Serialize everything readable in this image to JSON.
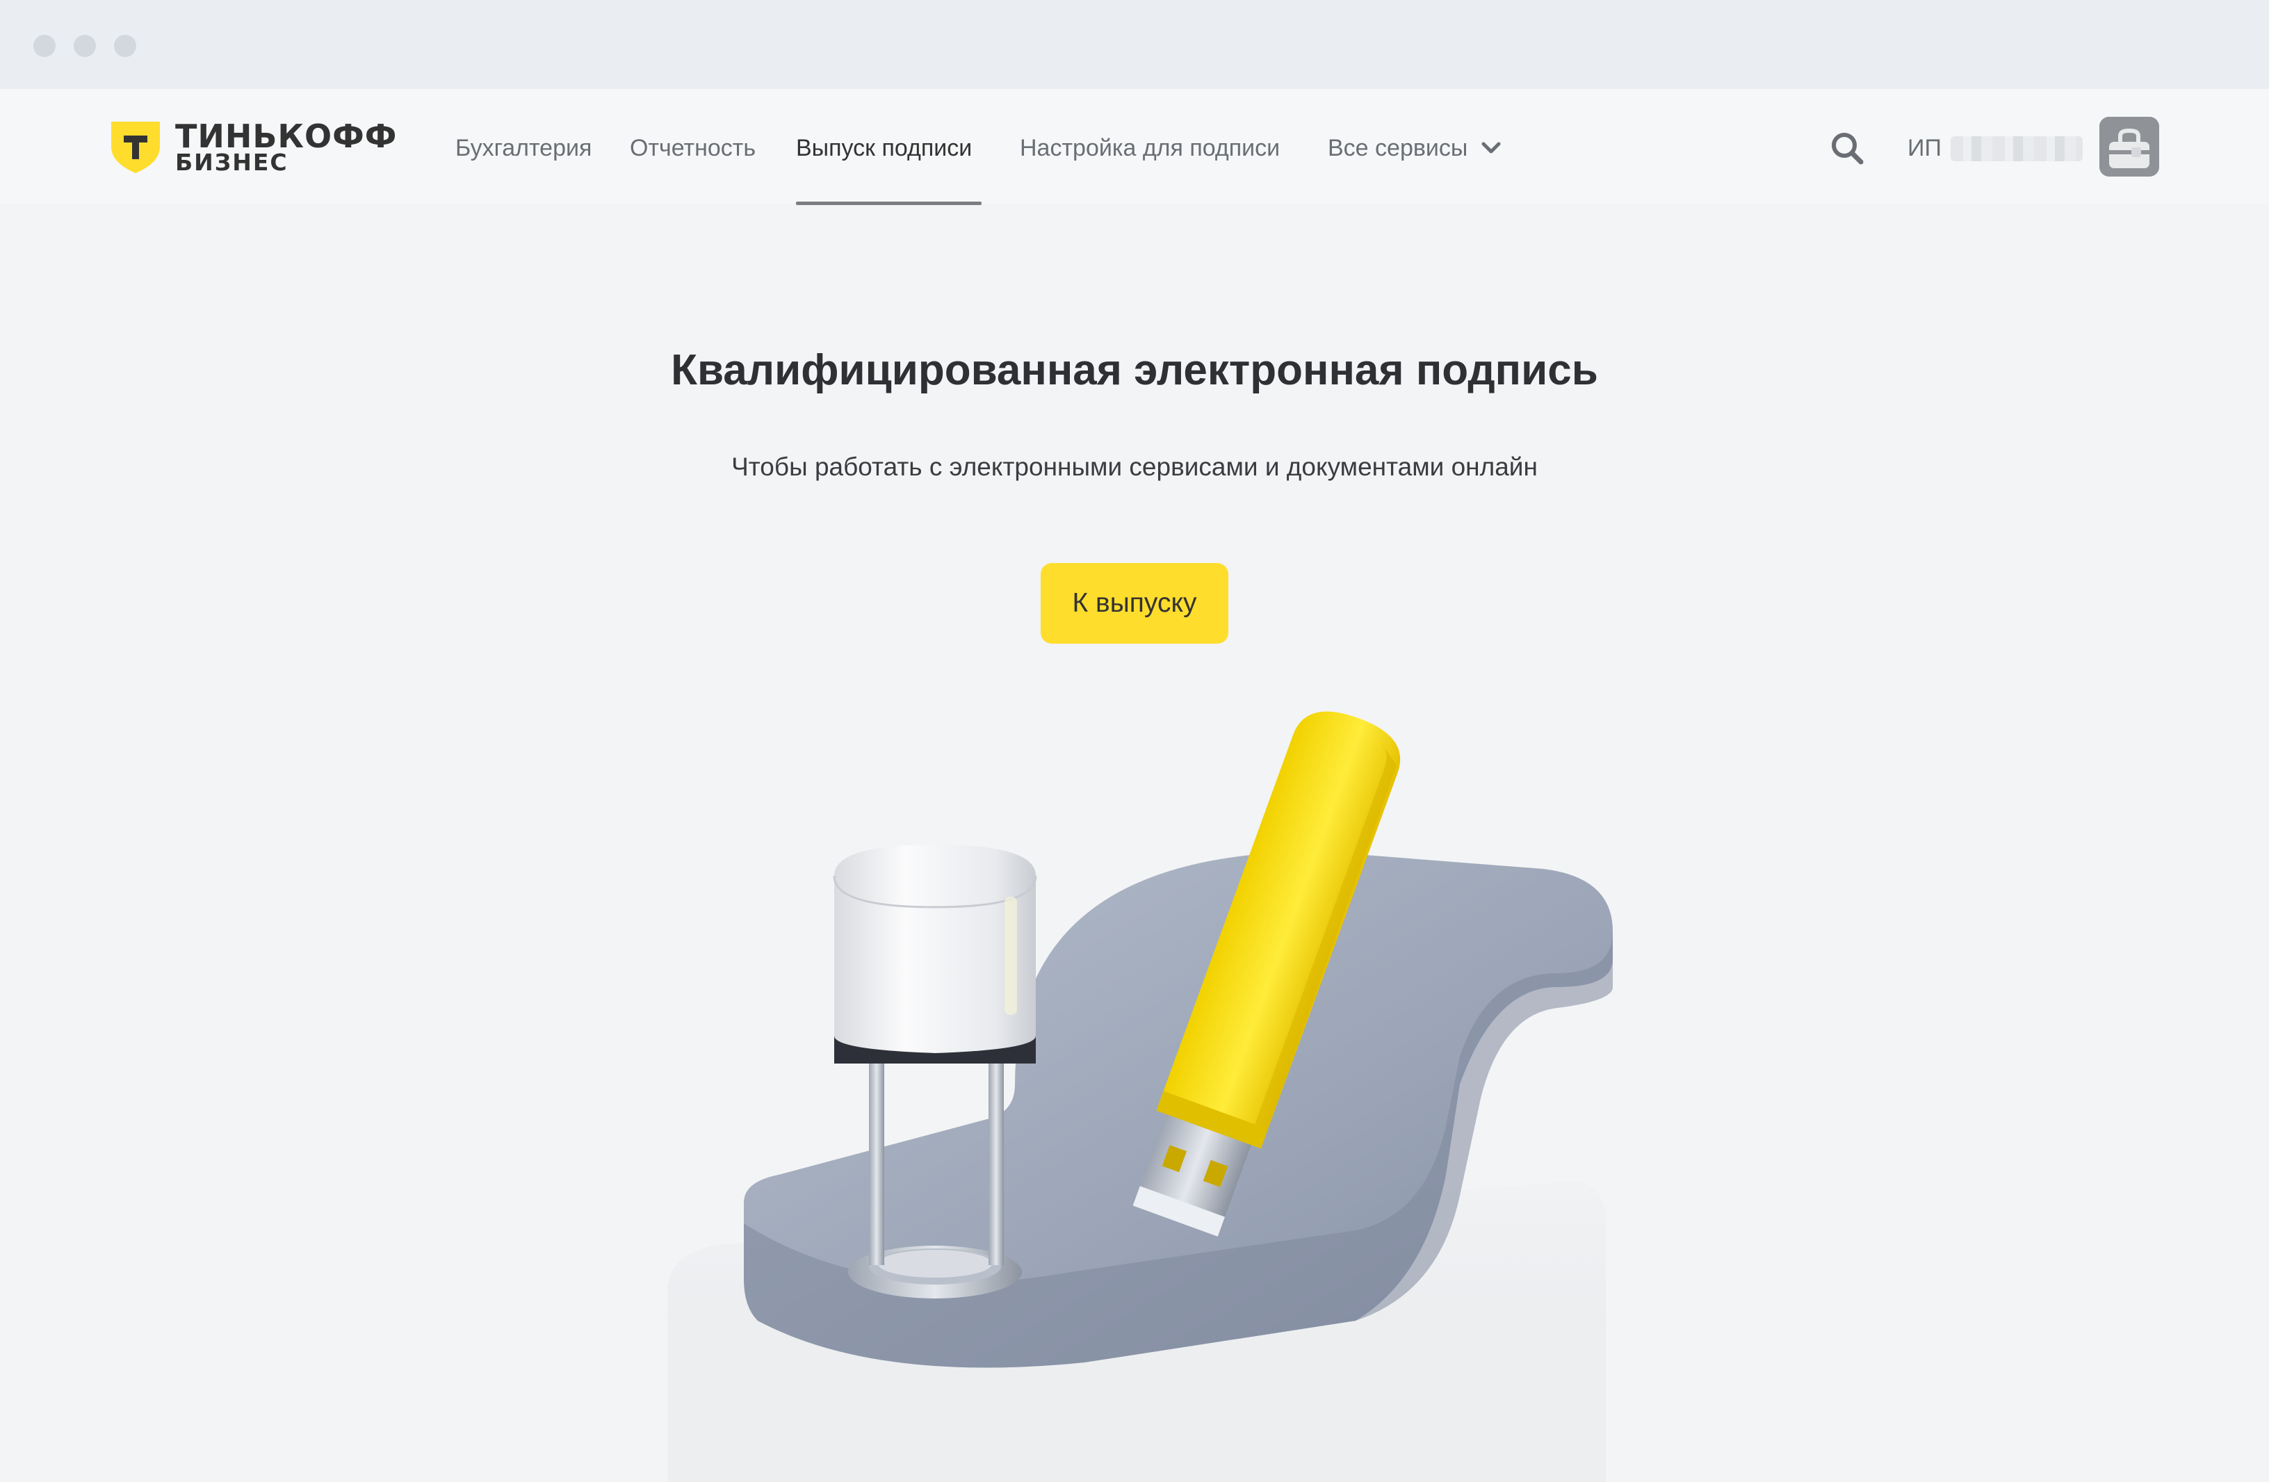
{
  "brand": {
    "name_line1": "ТИНЬКОФФ",
    "name_line2": "БИЗНЕС",
    "accent_color": "#ffdd2d"
  },
  "nav": {
    "items": [
      {
        "label": "Бухгалтерия",
        "active": false
      },
      {
        "label": "Отчетность",
        "active": false
      },
      {
        "label": "Выпуск подписи",
        "active": true
      },
      {
        "label": "Настройка для подписи",
        "active": false
      },
      {
        "label": "Все сервисы",
        "active": false,
        "has_dropdown": true
      }
    ]
  },
  "header_right": {
    "search_icon": "search-icon",
    "account_prefix": "ИП",
    "avatar_icon": "briefcase-icon"
  },
  "hero": {
    "title": "Квалифицированная электронная подпись",
    "subtitle": "Чтобы работать с электронными сервисами и документами онлайн",
    "cta_label": "К выпуску"
  },
  "illustration": {
    "objects": [
      "stamp",
      "usb-token",
      "stand"
    ]
  }
}
